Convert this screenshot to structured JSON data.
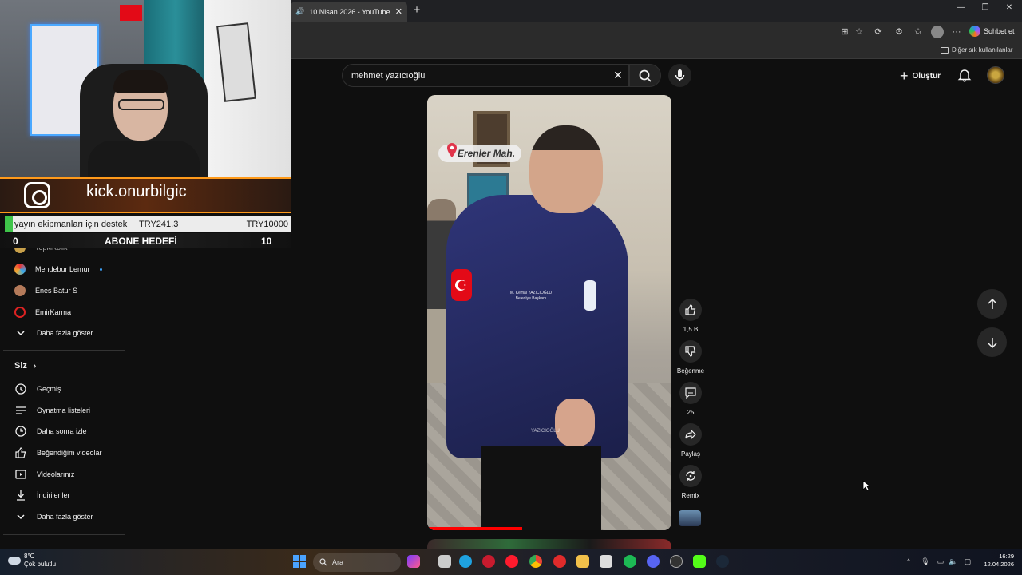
{
  "browser": {
    "tab_title": "10 Nisan 2026 - YouTube",
    "copilot_label": "Sohbet et",
    "other_bookmarks": "Diğer sık kullanılanlar"
  },
  "youtube": {
    "search_value": "mehmet yazıcıoğlu",
    "create_label": "Oluştur",
    "sidebar": {
      "subscriptions": [
        {
          "name": "TepkiKolik"
        },
        {
          "name": "Mendebur Lemur"
        },
        {
          "name": "Enes Batur S"
        },
        {
          "name": "EmirKarma"
        }
      ],
      "show_more_1": "Daha fazla göster",
      "you_heading": "Siz",
      "you_items": [
        {
          "label": "Geçmiş",
          "icon": "history-icon"
        },
        {
          "label": "Oynatma listeleri",
          "icon": "playlist-icon"
        },
        {
          "label": "Daha sonra izle",
          "icon": "watch-later-icon"
        },
        {
          "label": "Beğendiğim videolar",
          "icon": "liked-icon"
        },
        {
          "label": "Videolarınız",
          "icon": "your-videos-icon"
        },
        {
          "label": "İndirilenler",
          "icon": "downloads-icon"
        }
      ],
      "show_more_2": "Daha fazla göster"
    },
    "video": {
      "location_tag": "Erenler Mah.",
      "jacket_text": "M. Kemal YAZICIOĞLU\nBelediye Başkanı",
      "watermark": "YAZICIOĞLU",
      "progress": 0.39
    },
    "actions": {
      "likes": "1,5 B",
      "dislike_label": "Beğenme",
      "comments": "25",
      "share_label": "Paylaş",
      "remix_label": "Remix"
    }
  },
  "stream_overlay": {
    "channel_text": "kick.onurbilgic",
    "donation_label": "yayın ekipmanları için destek",
    "donation_current": "TRY241.3",
    "donation_goal": "TRY10000",
    "sub_goal_current": "0",
    "sub_goal_label": "ABONE HEDEFİ",
    "sub_goal_target": "10"
  },
  "taskbar": {
    "temperature": "8°C",
    "weather": "Çok bulutlu",
    "search_placeholder": "Ara",
    "time": "16:29",
    "date": "12.04.2026"
  },
  "colors": {
    "background": "#0f0f0f",
    "progress": "#ff0000",
    "donation_bar": "#3fc44a",
    "banner_accent": "#ff9a1a"
  }
}
